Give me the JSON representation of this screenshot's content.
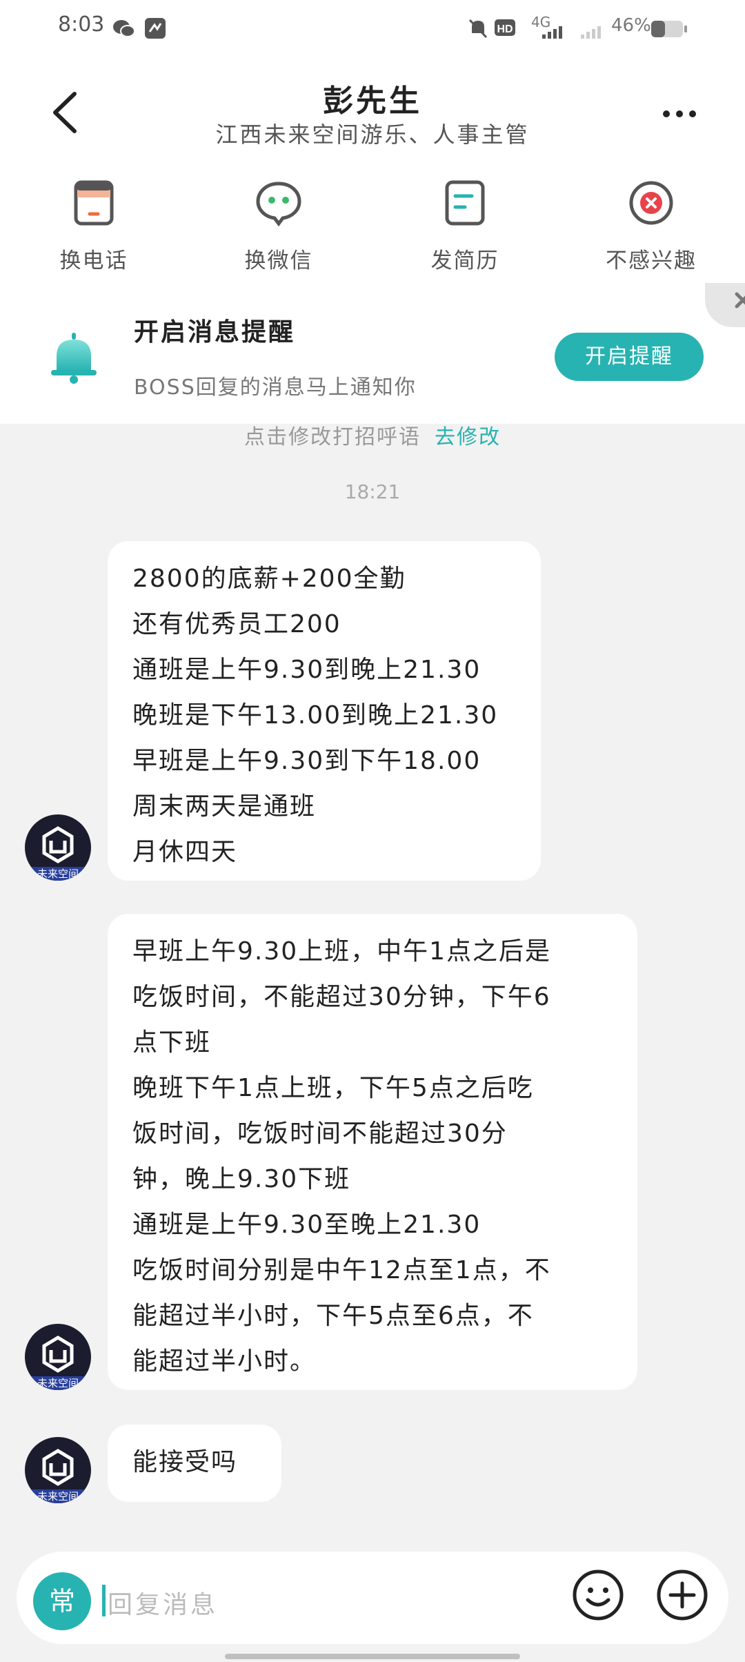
{
  "status_bar": {
    "time": "8:03",
    "network": "4G",
    "battery": "46%"
  },
  "header": {
    "title": "彭先生",
    "subtitle": "江西未来空间游乐、人事主管"
  },
  "actions": [
    {
      "label": "换电话",
      "icon": "phone-swap-icon"
    },
    {
      "label": "换微信",
      "icon": "wechat-icon"
    },
    {
      "label": "发简历",
      "icon": "resume-icon"
    },
    {
      "label": "不感兴趣",
      "icon": "not-interested-icon"
    }
  ],
  "notify_banner": {
    "title": "开启消息提醒",
    "subtitle": "BOSS回复的消息马上通知你",
    "button": "开启提醒"
  },
  "chat": {
    "hint": "点击修改打招呼语",
    "hint_link": "去修改",
    "timestamp": "18:21",
    "avatar_text": "未来空间",
    "messages": [
      {
        "lines": [
          "2800的底薪+200全勤",
          "还有优秀员工200",
          "通班是上午9.30到晚上21.30",
          "晚班是下午13.00到晚上21.30",
          "早班是上午9.30到下午18.00",
          "周末两天是通班",
          "月休四天"
        ]
      },
      {
        "lines": [
          "早班上午9.30上班，中午1点之后是",
          "吃饭时间，不能超过30分钟，下午6",
          "点下班",
          "晚班下午1点上班，下午5点之后吃",
          "饭时间，吃饭时间不能超过30分",
          "钟，晚上9.30下班",
          "通班是上午9.30至晚上21.30",
          "吃饭时间分别是中午12点至1点，不",
          "能超过半小时，下午5点至6点，不",
          "能超过半小时。"
        ]
      },
      {
        "lines": [
          "能接受吗"
        ]
      }
    ]
  },
  "input": {
    "quick_label": "常",
    "placeholder": "回复消息"
  },
  "colors": {
    "accent": "#27b3b1",
    "background": "#f2f2f2",
    "bubble": "#ffffff"
  }
}
